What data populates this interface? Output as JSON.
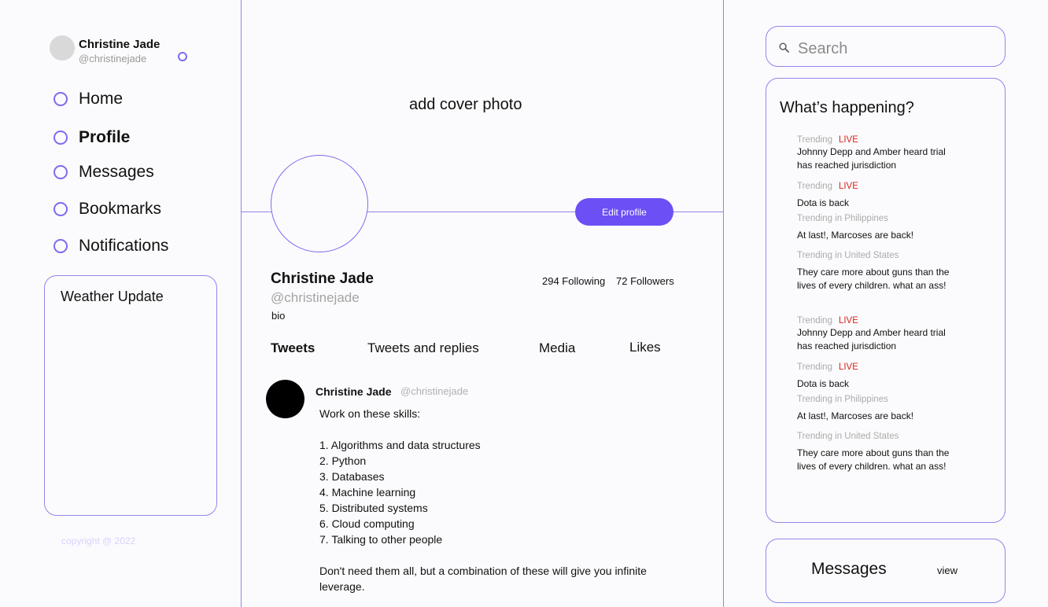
{
  "user": {
    "name": "Christine Jade",
    "handle": "@christinejade"
  },
  "nav": [
    "Home",
    "Profile",
    "Messages",
    "Bookmarks",
    "Notifications"
  ],
  "weather": {
    "title": "Weather Update"
  },
  "copyright": "copyright @ 2022",
  "cover": {
    "text": "add cover photo"
  },
  "profile": {
    "edit_label": "Edit profile",
    "name": "Christine Jade",
    "handle": "@christinejade",
    "bio": "bio",
    "following": "294 Following",
    "followers": "72 Followers"
  },
  "tabs": [
    "Tweets",
    "Tweets and replies",
    "Media",
    "Likes"
  ],
  "tweet": {
    "name": "Christine Jade",
    "handle": "@christinejade",
    "intro": "Work on these skills:",
    "skills": [
      "1. Algorithms and data structures",
      "2. Python",
      "3. Databases",
      "4. Machine learning",
      "5. Distributed systems",
      "6. Cloud computing",
      "7. Talking to other people"
    ],
    "outro": "Don't need them all, but a combination of these will give you infinite leverage."
  },
  "search": {
    "placeholder": "Search"
  },
  "happening": {
    "title": "What’s happening?",
    "trends": [
      {
        "meta": "Trending",
        "live": "LIVE",
        "text": "Johnny Depp and Amber heard trial has reached jurisdiction"
      },
      {
        "meta": "Trending",
        "live": "LIVE",
        "text": "Dota is back"
      },
      {
        "meta": "Trending in Philippines",
        "live": "",
        "text": "At last!, Marcoses are back!"
      },
      {
        "meta": "Trending in United States",
        "live": "",
        "text": "They care more about guns than the lives of every children. what an ass!"
      },
      {
        "meta": "Trending",
        "live": "LIVE",
        "text": "Johnny Depp and Amber heard trial has reached jurisdiction"
      },
      {
        "meta": "Trending",
        "live": "LIVE",
        "text": "Dota is back"
      },
      {
        "meta": "Trending in Philippines",
        "live": "",
        "text": "At last!, Marcoses are back!"
      },
      {
        "meta": "Trending in United States",
        "live": "",
        "text": "They care more about guns than the lives of every children. what an ass!"
      }
    ]
  },
  "messages": {
    "title": "Messages",
    "view_label": "view"
  }
}
